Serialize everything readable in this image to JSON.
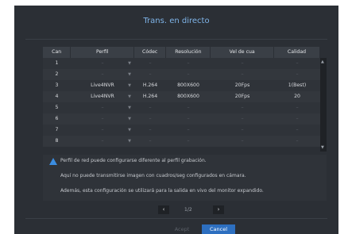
{
  "dialog": {
    "title": "Trans. en directo"
  },
  "table": {
    "headers": [
      "Can",
      "Perfil",
      "Códec",
      "Resolución",
      "Vel de cua",
      "Calidad"
    ],
    "rows": [
      [
        "1",
        "–",
        "–",
        "–",
        "–",
        "–"
      ],
      [
        "2",
        "–",
        "–",
        "–",
        "–",
        "–"
      ],
      [
        "3",
        "Live4NVR",
        "H.264",
        "800X600",
        "20Fps",
        "1(Best)"
      ],
      [
        "4",
        "Live4NVR",
        "H.264",
        "800X600",
        "20Fps",
        "20"
      ],
      [
        "5",
        "–",
        "–",
        "–",
        "–",
        "–"
      ],
      [
        "6",
        "–",
        "–",
        "–",
        "–",
        "–"
      ],
      [
        "7",
        "–",
        "–",
        "–",
        "–",
        "–"
      ],
      [
        "8",
        "–",
        "–",
        "–",
        "–",
        "–"
      ]
    ]
  },
  "notes": [
    "Perfil de red puede configurarse diferente al perfil grabación.",
    "Aquí no puede transmitirse imagen con cuadros/seg configurados en cámara.",
    "Además, esta configuración se utilizará para la salida en vivo del monitor expandido."
  ],
  "pagination": {
    "current": "1/2"
  },
  "buttons": {
    "accept": "Acept",
    "cancel": "Cancel"
  },
  "colors": {
    "accent": "#2d6fc0",
    "title": "#7fb4e8",
    "background": "#2b2f35"
  }
}
